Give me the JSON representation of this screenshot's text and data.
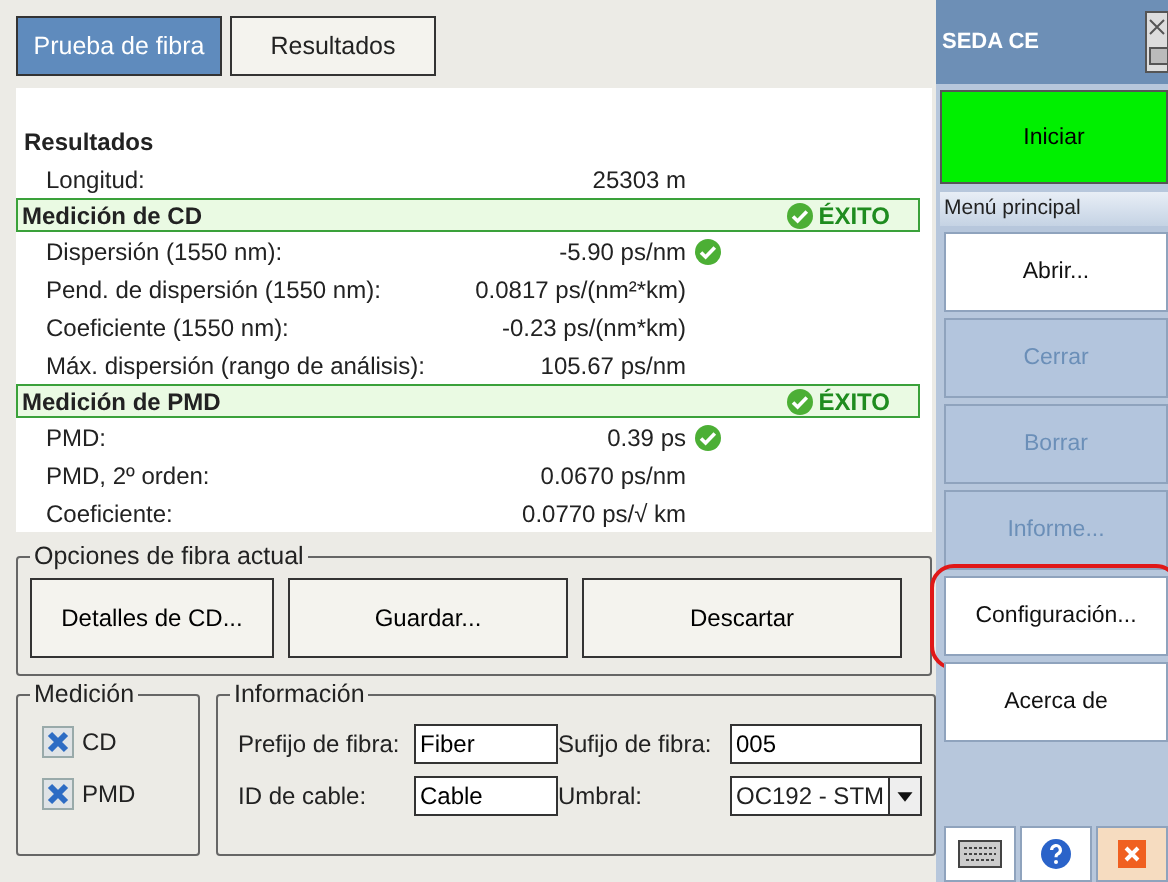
{
  "tabs": [
    {
      "label": "Prueba de fibra",
      "selected": true
    },
    {
      "label": "Resultados",
      "selected": false
    }
  ],
  "results": {
    "title": "Resultados",
    "rows": [
      {
        "kind": "row",
        "label": "Longitud:",
        "value": "25303 m",
        "pass": false
      },
      {
        "kind": "section",
        "label": "Medición de CD",
        "status": "ÉXITO",
        "pass": true
      },
      {
        "kind": "row",
        "label": "Dispersión (1550 nm):",
        "value": "-5.90 ps/nm",
        "pass": true
      },
      {
        "kind": "row",
        "label": "Pend. de dispersión (1550 nm):",
        "value": "0.0817 ps/(nm²*km)",
        "pass": false
      },
      {
        "kind": "row",
        "label": "Coeficiente (1550 nm):",
        "value": "-0.23 ps/(nm*km)",
        "pass": false
      },
      {
        "kind": "row",
        "label": "Máx. dispersión (rango de análisis):",
        "value": "105.67 ps/nm",
        "pass": false
      },
      {
        "kind": "section",
        "label": "Medición de PMD",
        "status": "ÉXITO",
        "pass": true
      },
      {
        "kind": "row",
        "label": "PMD:",
        "value": "0.39 ps",
        "pass": true
      },
      {
        "kind": "row",
        "label": "PMD, 2º orden:",
        "value": "0.0670 ps/nm",
        "pass": false
      },
      {
        "kind": "row",
        "label": "Coeficiente:",
        "value": "0.0770 ps/√ km",
        "pass": false
      }
    ]
  },
  "fiber_options": {
    "title": "Opciones de fibra actual",
    "buttons": [
      "Detalles de CD...",
      "Guardar...",
      "Descartar"
    ]
  },
  "measurement": {
    "title": "Medición",
    "items": [
      {
        "label": "CD",
        "checked": true
      },
      {
        "label": "PMD",
        "checked": true
      }
    ]
  },
  "information": {
    "title": "Información",
    "fields": [
      {
        "label": "Prefijo de fibra:",
        "value": "Fiber",
        "kind": "input"
      },
      {
        "label": "Sufijo de fibra:",
        "value": "005",
        "kind": "input"
      },
      {
        "label": "ID de cable:",
        "value": "Cable",
        "kind": "input"
      },
      {
        "label": "Umbral:",
        "value": "OC192 - STM",
        "kind": "select"
      }
    ]
  },
  "sidebar": {
    "title": "SEDA CE",
    "start_button": "Iniciar",
    "menu_title": "Menú principal",
    "items": [
      {
        "label": "Abrir...",
        "disabled": false,
        "highlighted": false
      },
      {
        "label": "Cerrar",
        "disabled": true,
        "highlighted": false
      },
      {
        "label": "Borrar",
        "disabled": true,
        "highlighted": false
      },
      {
        "label": "Informe...",
        "disabled": true,
        "highlighted": false
      },
      {
        "label": "Configuración...",
        "disabled": false,
        "highlighted": true
      },
      {
        "label": "Acerca de",
        "disabled": false,
        "highlighted": false
      }
    ]
  }
}
